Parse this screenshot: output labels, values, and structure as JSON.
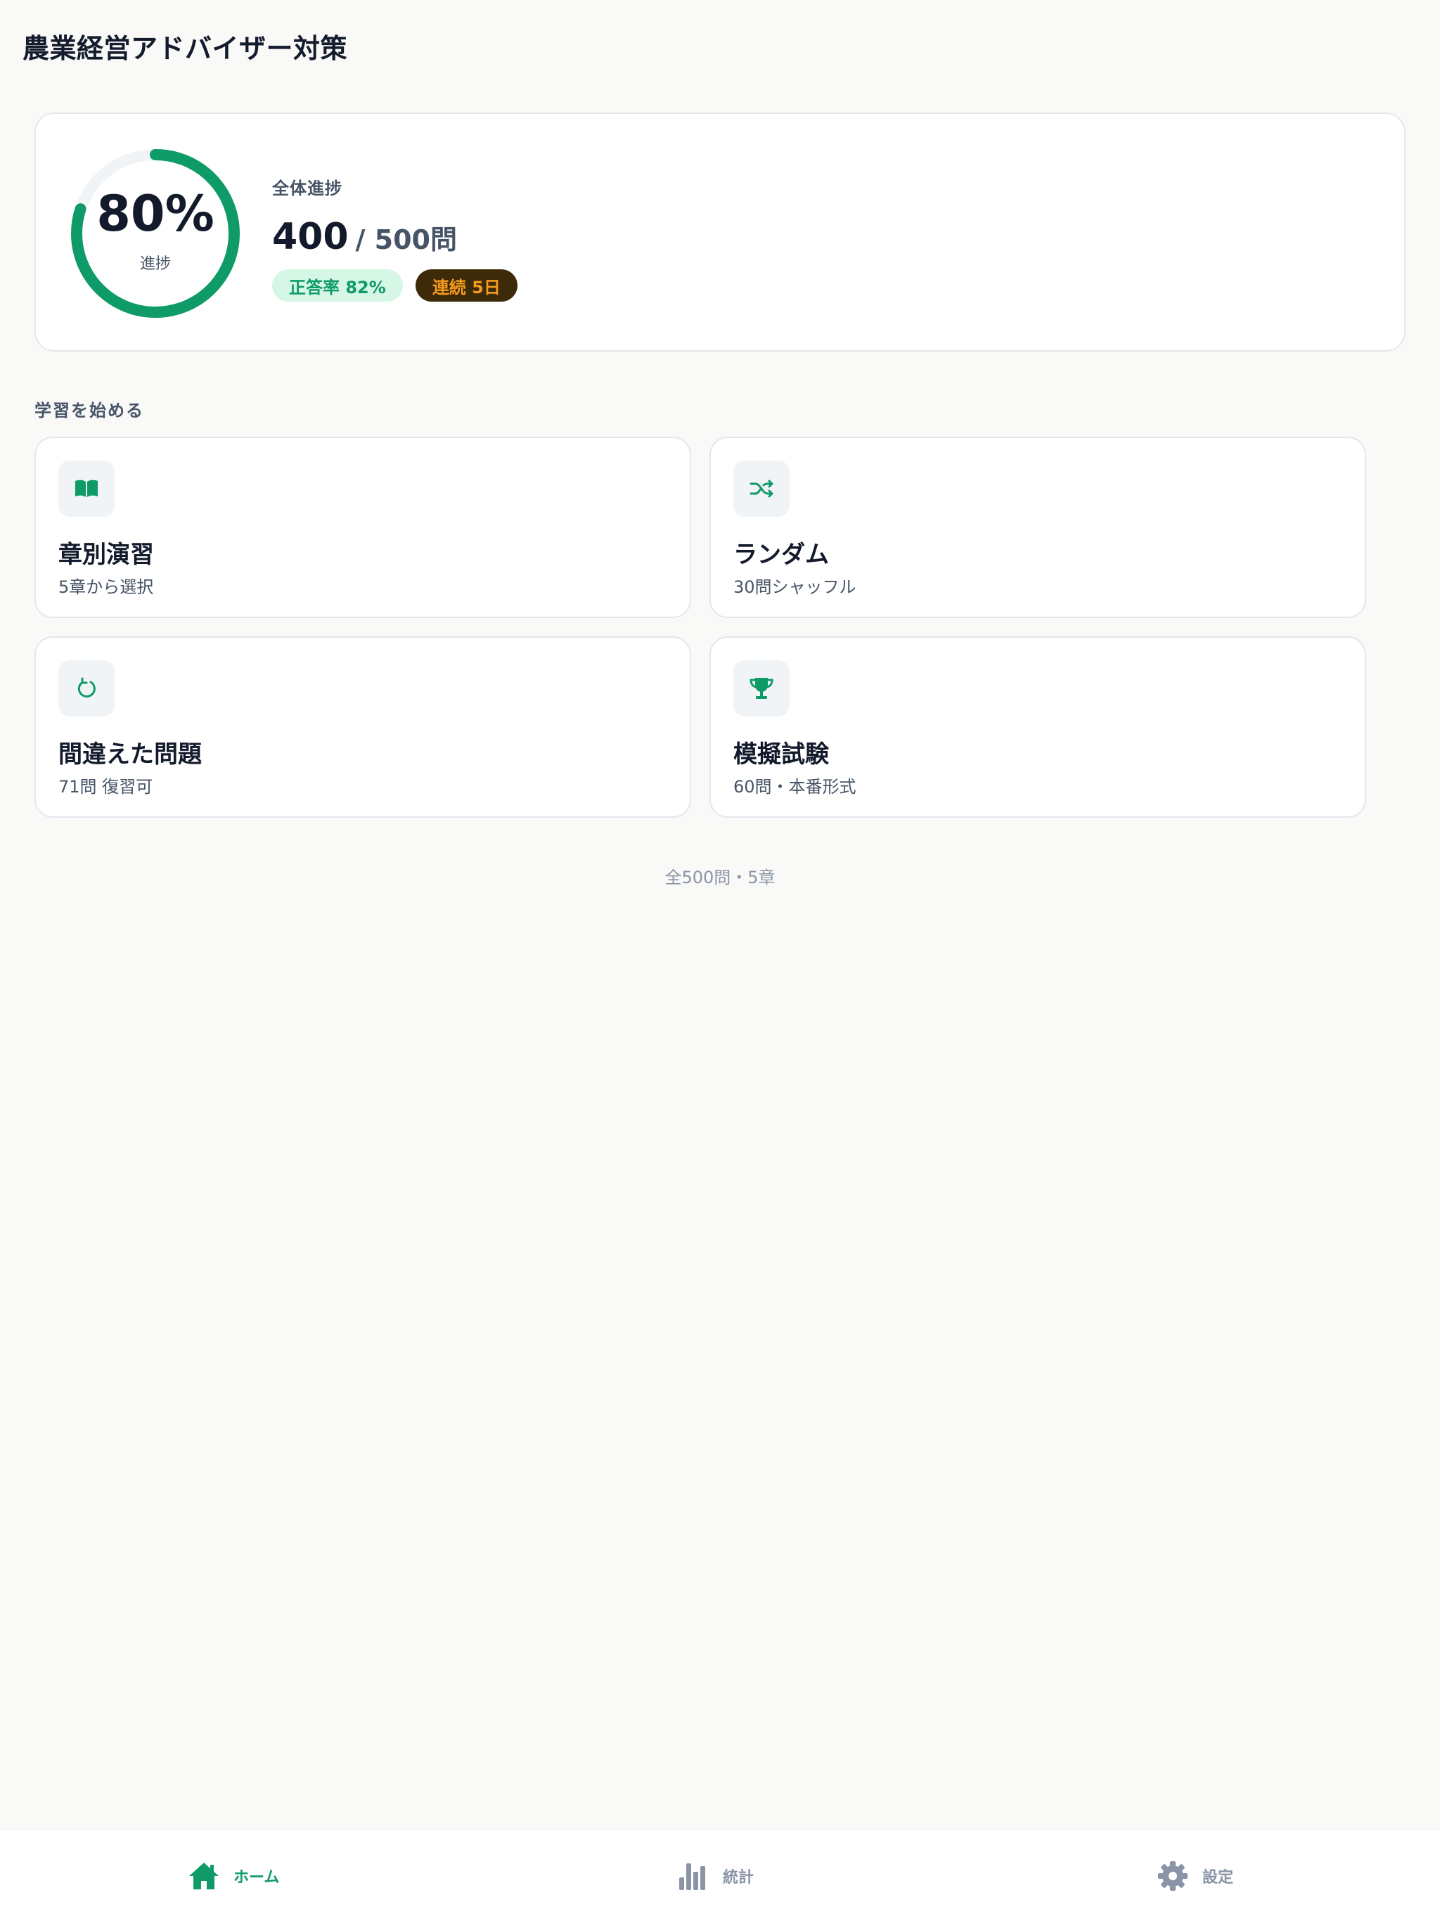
{
  "app": {
    "title": "農業経営アドバイザー対策"
  },
  "progress": {
    "percent_label": "80%",
    "percent_value": 0.8,
    "ring_label": "進捗",
    "heading": "全体進捗",
    "done": "400",
    "total": "/ 500問",
    "accuracy_badge": "正答率 82%",
    "streak_badge": "連続 5日",
    "ring_color": "#0f9b68",
    "ring_track_color": "#f1f4f7"
  },
  "section": {
    "label": "学習を始める"
  },
  "menu": [
    {
      "title": "章別演習",
      "subtitle": "5章から選択",
      "icon": "book-icon"
    },
    {
      "title": "ランダム",
      "subtitle": "30問シャッフル",
      "icon": "shuffle-icon"
    },
    {
      "title": "間違えた問題",
      "subtitle": "71問 復習可",
      "icon": "refresh-icon"
    },
    {
      "title": "模擬試験",
      "subtitle": "60問・本番形式",
      "icon": "trophy-icon"
    }
  ],
  "footer": {
    "note": "全500問・5章"
  },
  "tabs": [
    {
      "label": "ホーム",
      "icon": "home-icon",
      "active": true
    },
    {
      "label": "統計",
      "icon": "bar-chart-icon",
      "active": false
    },
    {
      "label": "設定",
      "icon": "gear-icon",
      "active": false
    }
  ],
  "colors": {
    "accent": "#0f9b68",
    "inactive": "#8a94a6"
  }
}
